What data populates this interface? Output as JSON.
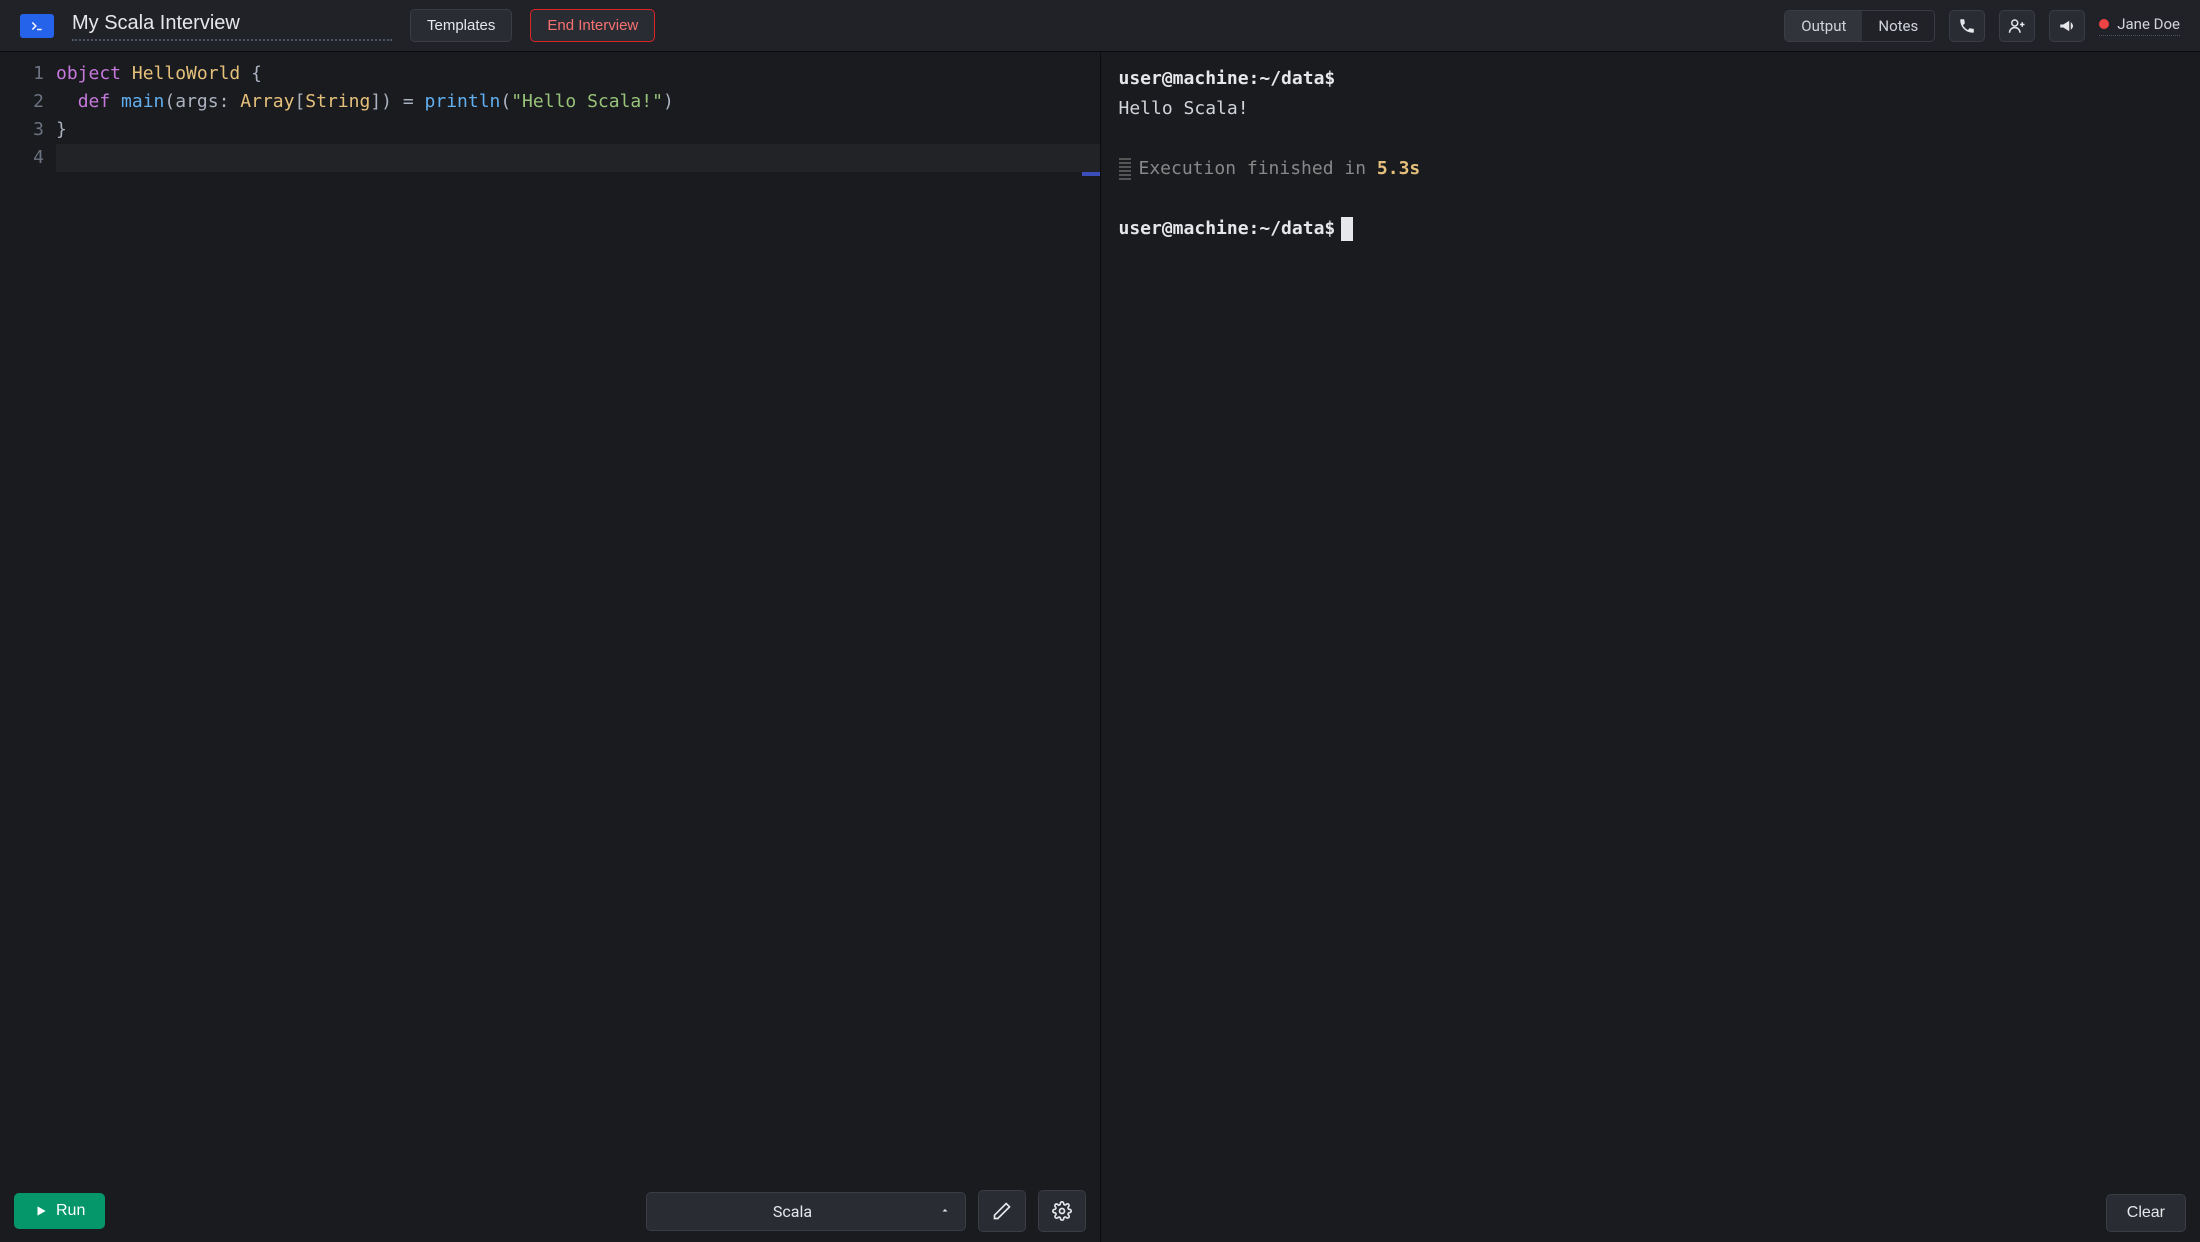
{
  "header": {
    "title": "My Scala Interview",
    "templates_label": "Templates",
    "end_interview_label": "End Interview",
    "tabs": {
      "output": "Output",
      "notes": "Notes"
    },
    "user_name": "Jane Doe"
  },
  "editor": {
    "line_numbers": [
      "1",
      "2",
      "3",
      "4"
    ],
    "code_tokens": [
      [
        {
          "t": "object",
          "c": "k"
        },
        {
          "t": " ",
          "c": "txt"
        },
        {
          "t": "HelloWorld",
          "c": "d"
        },
        {
          "t": " {",
          "c": "p"
        }
      ],
      [
        {
          "t": "  ",
          "c": "txt"
        },
        {
          "t": "def",
          "c": "k"
        },
        {
          "t": " ",
          "c": "txt"
        },
        {
          "t": "main",
          "c": "f"
        },
        {
          "t": "(args: ",
          "c": "p"
        },
        {
          "t": "Array",
          "c": "d"
        },
        {
          "t": "[",
          "c": "p"
        },
        {
          "t": "String",
          "c": "d"
        },
        {
          "t": "]) = ",
          "c": "p"
        },
        {
          "t": "println",
          "c": "f"
        },
        {
          "t": "(",
          "c": "p"
        },
        {
          "t": "\"Hello Scala!\"",
          "c": "s"
        },
        {
          "t": ")",
          "c": "p"
        }
      ],
      [
        {
          "t": "}",
          "c": "p"
        }
      ],
      []
    ],
    "active_line_index": 3,
    "language": "Scala",
    "run_label": "Run"
  },
  "terminal": {
    "lines": [
      {
        "type": "prompt",
        "prompt": "user@machine:~/data$"
      },
      {
        "type": "output",
        "text": "Hello Scala!"
      },
      {
        "type": "blank"
      },
      {
        "type": "info",
        "prefix": "Execution finished in ",
        "time": "5.3s"
      },
      {
        "type": "blank"
      },
      {
        "type": "prompt_cursor",
        "prompt": "user@machine:~/data$"
      }
    ],
    "clear_label": "Clear"
  }
}
